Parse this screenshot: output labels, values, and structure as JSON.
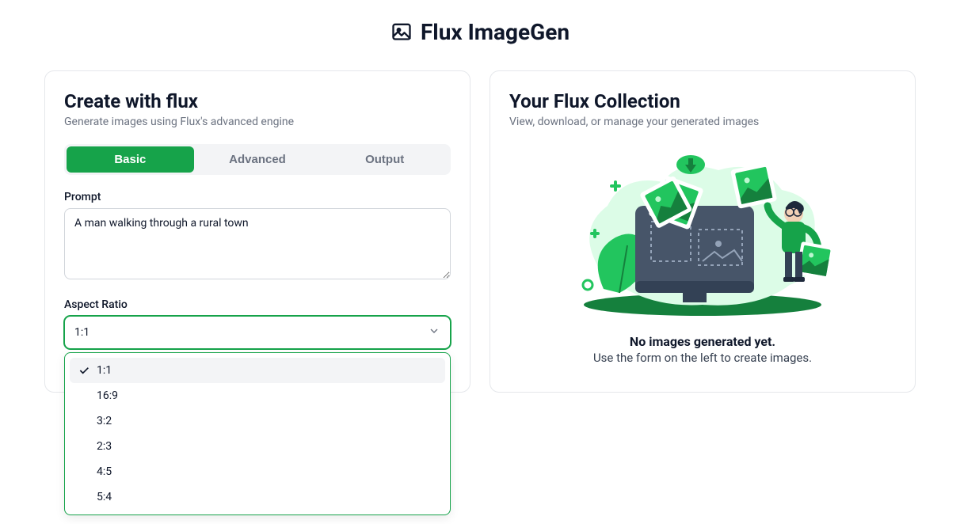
{
  "header": {
    "title": "Flux ImageGen"
  },
  "create": {
    "title": "Create with flux",
    "subtitle": "Generate images using Flux's advanced engine",
    "tabs": [
      {
        "label": "Basic",
        "active": true
      },
      {
        "label": "Advanced",
        "active": false
      },
      {
        "label": "Output",
        "active": false
      }
    ],
    "prompt": {
      "label": "Prompt",
      "value": "A man walking through a rural town"
    },
    "aspect_ratio": {
      "label": "Aspect Ratio",
      "selected": "1:1",
      "options": [
        "1:1",
        "16:9",
        "3:2",
        "2:3",
        "4:5",
        "5:4"
      ]
    }
  },
  "collection": {
    "title": "Your Flux Collection",
    "subtitle": "View, download, or manage your generated images",
    "empty_title": "No images generated yet.",
    "empty_text": "Use the form on the left to create images."
  }
}
